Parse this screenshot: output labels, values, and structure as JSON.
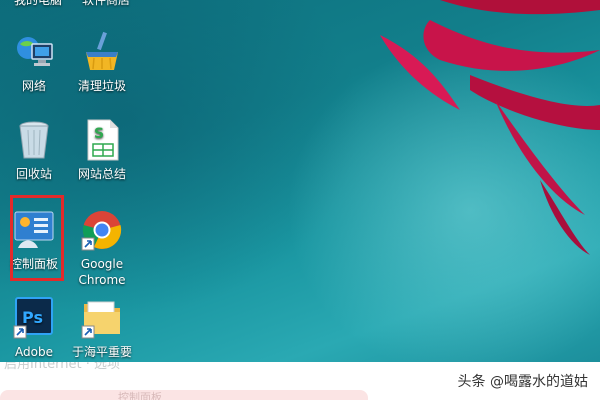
{
  "desktop": {
    "top_row": [
      "我的电脑",
      "软件商店"
    ],
    "icons": [
      {
        "name": "network",
        "label": "网络",
        "icon": "network-icon"
      },
      {
        "name": "clean-trash",
        "label": "清理垃圾",
        "icon": "broom-icon"
      },
      {
        "name": "recycle-bin",
        "label": "回收站",
        "icon": "recycle-bin-icon"
      },
      {
        "name": "site-summary",
        "label": "网站总结",
        "icon": "spreadsheet-icon"
      },
      {
        "name": "control-panel",
        "label": "控制面板",
        "icon": "control-panel-icon"
      },
      {
        "name": "google-chrome",
        "label_line1": "Google",
        "label_line2": "Chrome",
        "icon": "chrome-icon"
      },
      {
        "name": "adobe-photoshop",
        "label": "Adobe",
        "icon": "photoshop-icon"
      },
      {
        "name": "folder-yuhaiping",
        "label": "于海平重要",
        "icon": "folder-icon"
      }
    ],
    "selected": "控制面板",
    "colors": {
      "selection": "#e32a2a",
      "wallpaper": "#127f8b"
    }
  },
  "caption": {
    "ghost_text": "启用Internet · 选项",
    "bar_text": "控制面板",
    "watermark": "头条 @喝露水的道姑"
  }
}
